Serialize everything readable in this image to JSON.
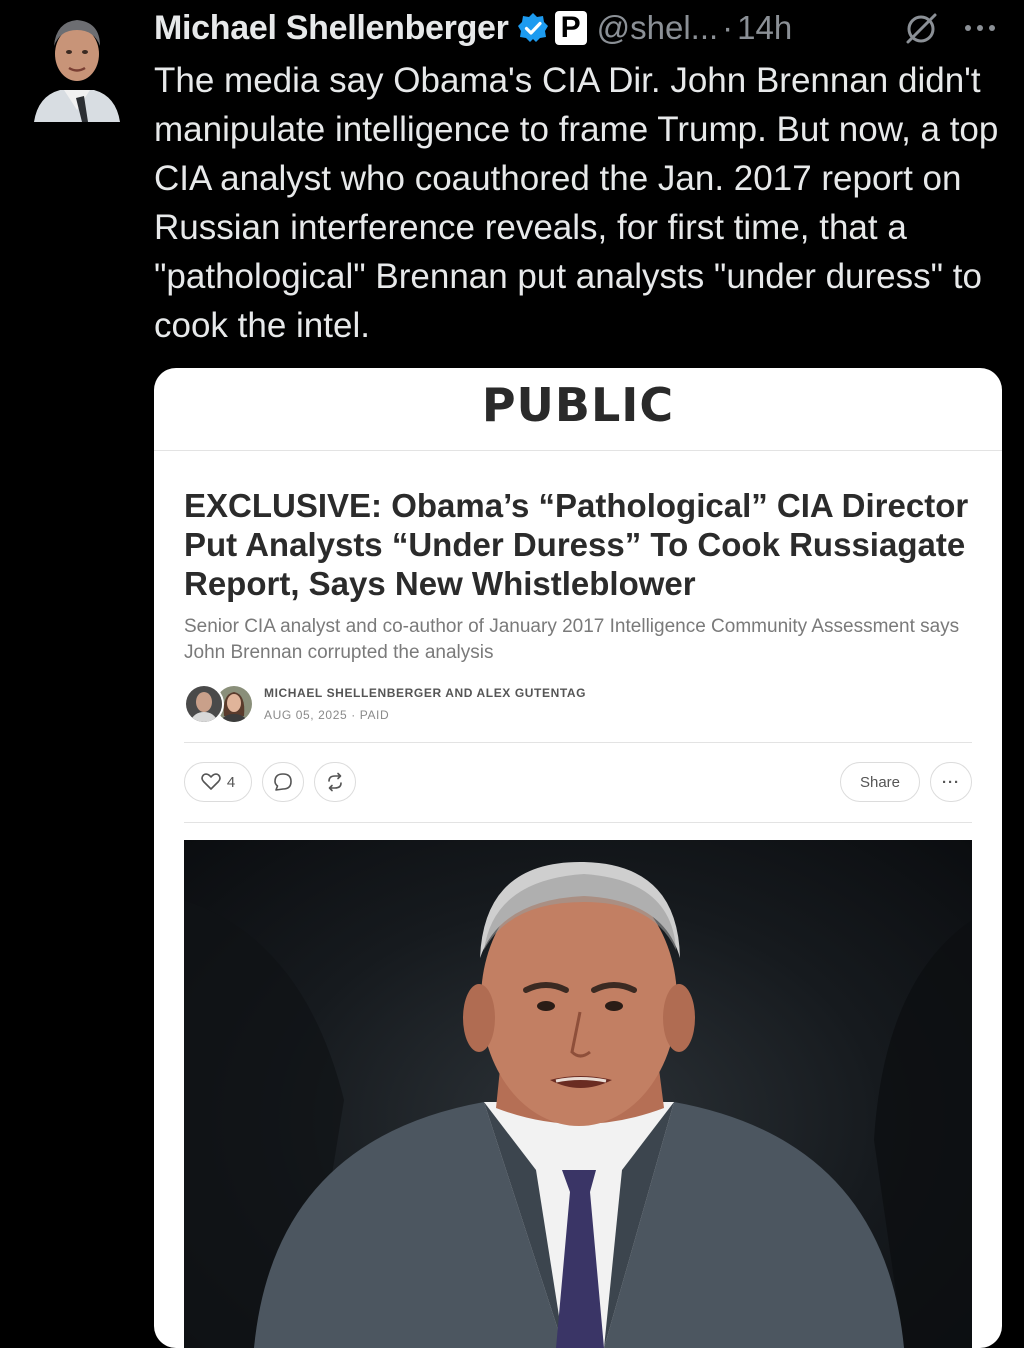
{
  "tweet": {
    "author_name": "Michael Shellenberger",
    "handle": "@shel...",
    "separator": "·",
    "time": "14h",
    "affiliate_badge": "P",
    "verified": true,
    "icons": [
      "avatar",
      "verified-badge-icon",
      "grok-icon",
      "more-icon"
    ],
    "text": "The media say Obama's CIA Dir. John Brennan didn't manipulate intelligence to frame Trump. But now, a top CIA analyst who coauthored the Jan. 2017 report on Russian interference reveals, for first time, that a \"pathological\" Brennan put analysts \"under duress\" to cook the intel."
  },
  "card": {
    "publication": "PUBLIC",
    "title": "EXCLUSIVE: Obama’s “Pathological” CIA Director Put Analysts “Under Duress” To Cook Russiagate Report, Says New Whistleblower",
    "subtitle": "Senior CIA analyst and co-author of January 2017 Intelligence Community Assessment says John Brennan corrupted the analysis",
    "authors": "MICHAEL SHELLENBERGER AND ALEX GUTENTAG",
    "date": "AUG 05, 2025",
    "meta_separator": "·",
    "access": "PAID",
    "like_count": "4",
    "share_label": "Share",
    "more_label": "···"
  },
  "colors": {
    "background": "#000000",
    "text": "#e7e9ea",
    "muted": "#8b9096",
    "verified_blue": "#1d9bf0",
    "card_bg": "#ffffff"
  }
}
